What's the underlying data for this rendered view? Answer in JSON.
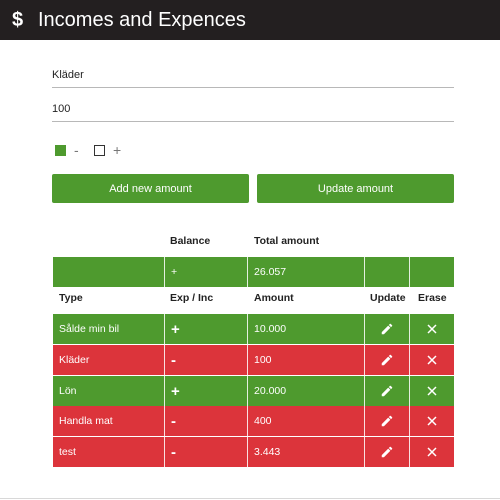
{
  "app": {
    "title": "Incomes and Expences",
    "logo_symbol": "$"
  },
  "form": {
    "name_value": "Kläder",
    "amount_value": "100",
    "toggle_minus": {
      "symbol": "-",
      "checked": true
    },
    "toggle_plus": {
      "symbol": "+",
      "checked": false
    },
    "add_button": "Add new amount",
    "update_button": "Update amount"
  },
  "summary": {
    "headers": {
      "balance": "Balance",
      "total": "Total amount"
    },
    "balance": "+",
    "total": "26.057"
  },
  "table": {
    "headers": {
      "type": "Type",
      "exp_inc": "Exp / Inc",
      "amount": "Amount",
      "update": "Update",
      "erase": "Erase"
    },
    "rows": [
      {
        "type": "Sålde min bil",
        "sign": "+",
        "amount": "10.000",
        "color": "#4e9a2e"
      },
      {
        "type": "Kläder",
        "sign": "-",
        "amount": "100",
        "color": "#dc343b"
      },
      {
        "type": "Lön",
        "sign": "+",
        "amount": "20.000",
        "color": "#4e9a2e"
      },
      {
        "type": "Handla mat",
        "sign": "-",
        "amount": "400",
        "color": "#dc343b"
      },
      {
        "type": "test",
        "sign": "-",
        "amount": "3.443",
        "color": "#dc343b"
      }
    ]
  },
  "colors": {
    "appbar": "#231f20",
    "income": "#4e9a2e",
    "expense": "#dc343b"
  },
  "icons": {
    "update": "pencil-icon",
    "erase": "close-icon"
  }
}
